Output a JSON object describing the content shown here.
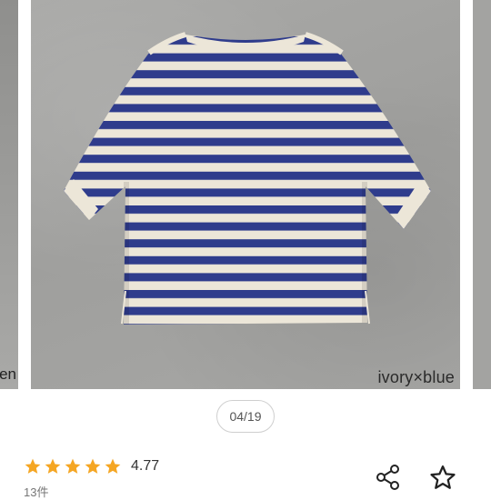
{
  "gallery": {
    "prev_caption": "en",
    "main_caption": "ivory×blue",
    "counter": "04/19"
  },
  "rating": {
    "value": "4.77",
    "reviews": "13件",
    "stars": 5,
    "star_color": "#f5a623"
  },
  "icons": {
    "share": "share-icon",
    "favorite": "star-outline-icon"
  },
  "colors": {
    "stripe_blue": "#2f3c8c",
    "stripe_ivory": "#ece6d8"
  }
}
